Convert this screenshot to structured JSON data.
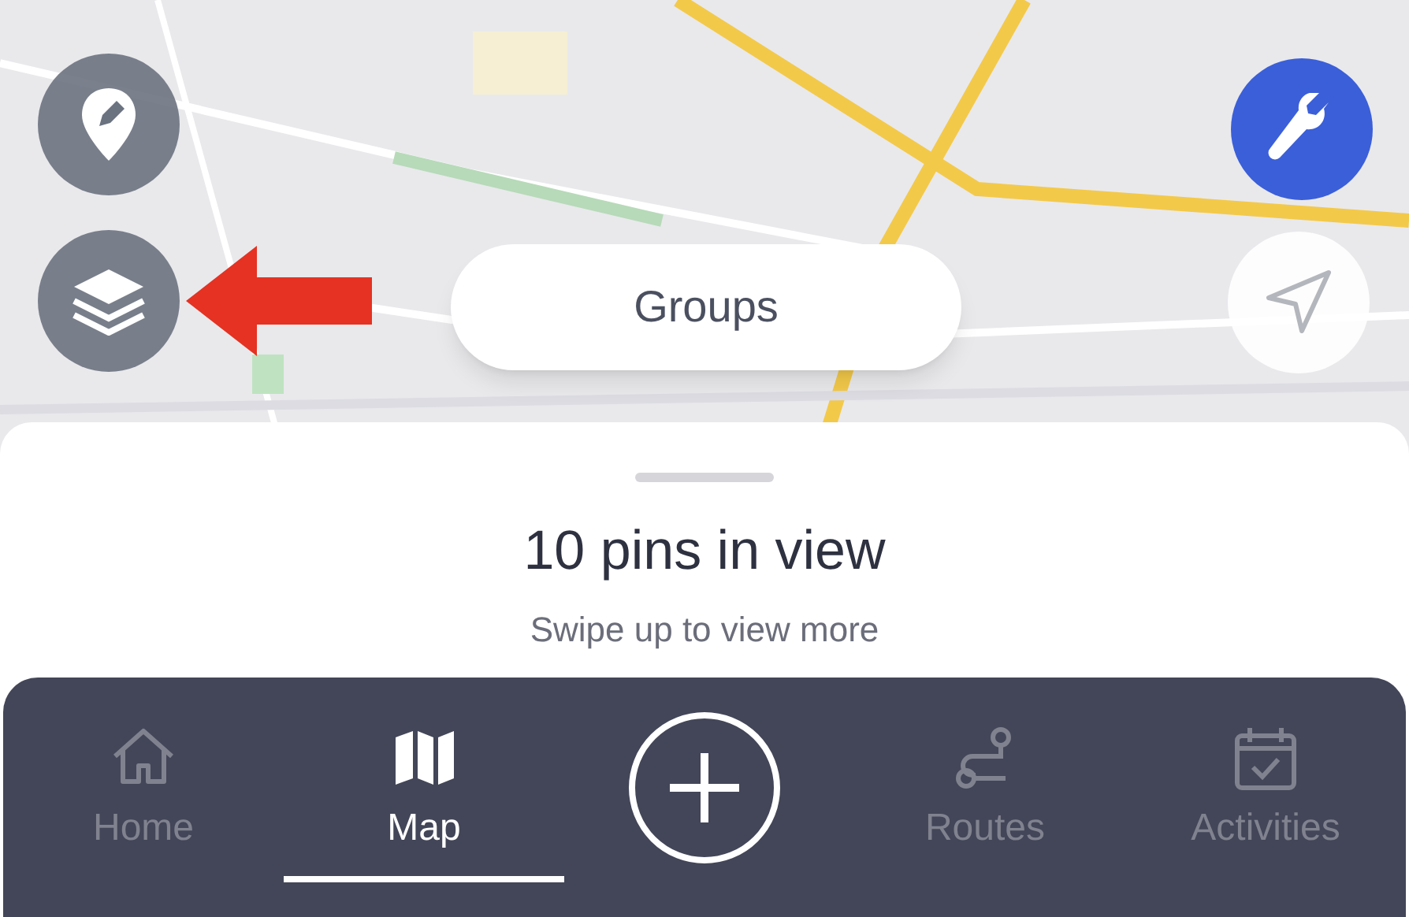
{
  "map_buttons": {
    "groups": "Groups"
  },
  "sheet": {
    "title": "10 pins in view",
    "subtitle": "Swipe up to view more"
  },
  "tabs": [
    {
      "kind": "home",
      "label": "Home",
      "selected": false
    },
    {
      "kind": "map",
      "label": "Map",
      "selected": true
    },
    {
      "kind": "add"
    },
    {
      "kind": "routes",
      "label": "Routes",
      "selected": false
    },
    {
      "kind": "activities",
      "label": "Activities",
      "selected": false
    }
  ]
}
